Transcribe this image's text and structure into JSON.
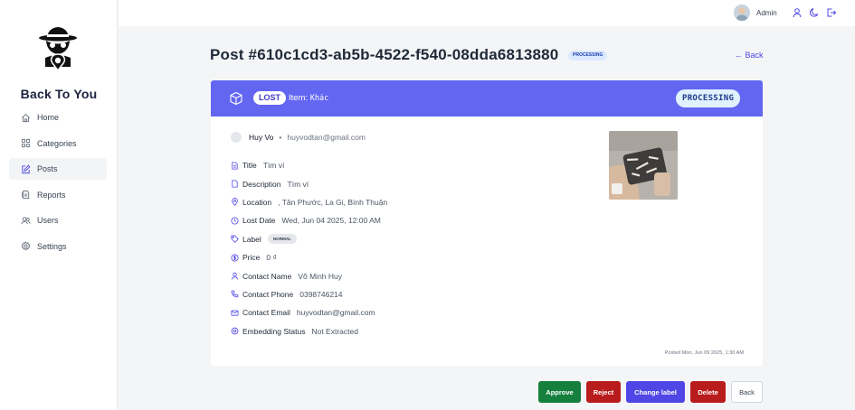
{
  "sidebar": {
    "brand": "Back To You",
    "items": [
      {
        "label": "Home",
        "icon": "home-icon"
      },
      {
        "label": "Categories",
        "icon": "grid-icon"
      },
      {
        "label": "Posts",
        "icon": "edit-icon"
      },
      {
        "label": "Reports",
        "icon": "document-icon"
      },
      {
        "label": "Users",
        "icon": "users-icon"
      },
      {
        "label": "Settings",
        "icon": "gear-icon"
      }
    ],
    "active": "Posts"
  },
  "topbar": {
    "user_name": "Admin",
    "icons": [
      "user-icon",
      "moon-icon",
      "logout-icon"
    ]
  },
  "page": {
    "title": "Post #610c1cd3-ab5b-4522-f540-08dda6813880",
    "status_badge": "PROCESSING",
    "back_link": "← Back"
  },
  "card": {
    "type_badge": "LOST",
    "item_prefix": "Item:",
    "item_name": "Khác",
    "status": "PROCESSING",
    "author_name": "Huy Vo",
    "author_email": "huyvodtan@gmail.com",
    "fields": {
      "title": {
        "label": "Title",
        "value": "Tìm ví"
      },
      "description": {
        "label": "Description",
        "value": "Tìm ví"
      },
      "location": {
        "label": "Location",
        "value": ", Tân Phước, La Gi, Bình Thuận"
      },
      "lost_date": {
        "label": "Lost Date",
        "value": "Wed, Jun 04 2025, 12:00 AM"
      },
      "label": {
        "label": "Label",
        "value": "NORMAL"
      },
      "price": {
        "label": "Price",
        "value": "0 ₫"
      },
      "contact_name": {
        "label": "Contact Name",
        "value": "Võ Minh Huy"
      },
      "contact_phone": {
        "label": "Contact Phone",
        "value": "0398746214"
      },
      "contact_email": {
        "label": "Contact Email",
        "value": "huyvodtan@gmail.com"
      },
      "embedding_status": {
        "label": "Embedding Status",
        "value": "Not Extracted"
      }
    },
    "posted": "Posted Mon, Jun 09 2025, 1:30 AM"
  },
  "actions": {
    "approve": "Approve",
    "reject": "Reject",
    "change_label": "Change label",
    "delete": "Delete",
    "back": "Back"
  },
  "colors": {
    "accent": "#6366f1",
    "approve": "#15803d",
    "reject": "#b91c1c",
    "change_label": "#4f46e5",
    "delete": "#b91c1c"
  }
}
